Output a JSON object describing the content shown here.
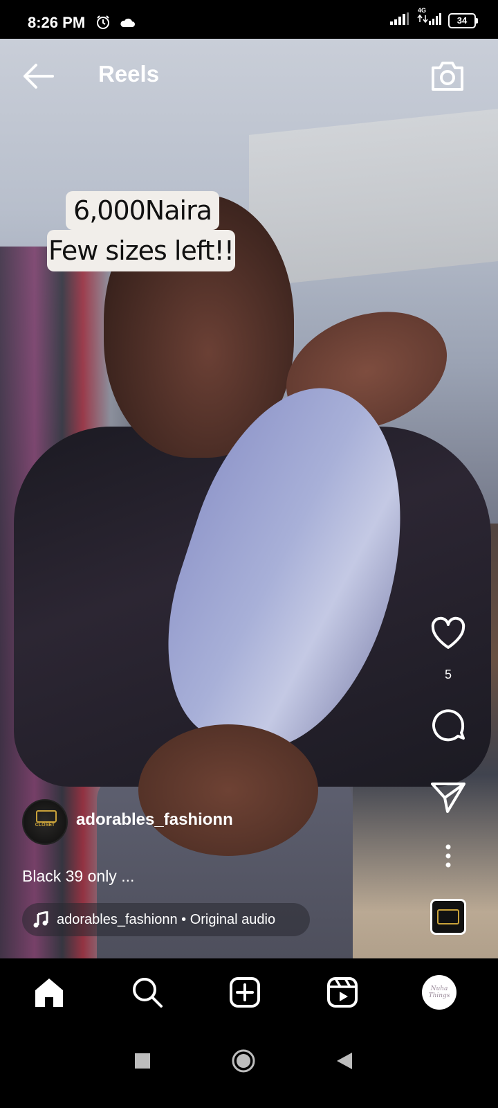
{
  "status_bar": {
    "time": "8:26 PM",
    "network": "4G",
    "battery": "34",
    "icons": [
      "alarm-icon",
      "cloud-icon",
      "signal-icon",
      "signal-4g-icon",
      "battery-icon"
    ]
  },
  "header": {
    "title": "Reels",
    "back_icon": "arrow-left-icon",
    "camera_icon": "camera-icon"
  },
  "video": {
    "sticker_line1": "6,000Naira",
    "sticker_line2": "Few sizes left!!"
  },
  "actions": {
    "like_count": "5",
    "icons": [
      "heart-icon",
      "comment-icon",
      "send-icon",
      "more-icon"
    ]
  },
  "post": {
    "username": "adorables_fashionn",
    "avatar_text": "CLOSET",
    "caption": "Black 39 only ...",
    "audio": "adorables_fashionn • Original audio"
  },
  "nav": {
    "items": [
      "home-icon",
      "search-icon",
      "create-icon",
      "reels-icon",
      "profile-avatar"
    ],
    "profile_text": "Nuha Things"
  },
  "colors": {
    "background": "#000000",
    "text": "#ffffff",
    "sticker_bg": "#f1eeea",
    "accent_gold": "#c9a23a"
  }
}
